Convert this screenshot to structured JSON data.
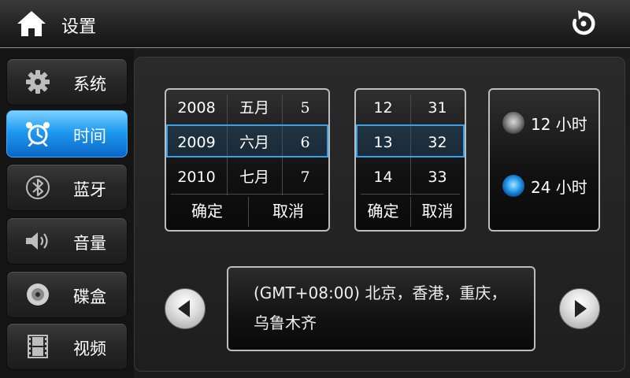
{
  "header": {
    "title": "设置",
    "home_icon": "home-icon",
    "back_icon": "back-icon"
  },
  "sidebar": {
    "items": [
      {
        "label": "系统",
        "icon": "gear-icon",
        "active": false
      },
      {
        "label": "时间",
        "icon": "alarm-clock-icon",
        "active": true
      },
      {
        "label": "蓝牙",
        "icon": "bluetooth-icon",
        "active": false
      },
      {
        "label": "音量",
        "icon": "speaker-icon",
        "active": false
      },
      {
        "label": "碟盒",
        "icon": "disc-icon",
        "active": false
      },
      {
        "label": "视频",
        "icon": "film-icon",
        "active": false
      }
    ]
  },
  "date_picker": {
    "years": [
      "2008",
      "2009",
      "2010"
    ],
    "months": [
      "五月",
      "六月",
      "七月"
    ],
    "days": [
      "5",
      "6",
      "7"
    ],
    "confirm": "确定",
    "cancel": "取消"
  },
  "time_picker": {
    "hours": [
      "12",
      "13",
      "14"
    ],
    "minutes": [
      "31",
      "32",
      "33"
    ],
    "confirm": "确定",
    "cancel": "取消"
  },
  "time_format": {
    "options": [
      "12 小时",
      "24 小时"
    ],
    "selected": "24 小时"
  },
  "timezone": {
    "line1": "(GMT+08:00) 北京，香港，重庆，",
    "line2": "乌鲁木齐"
  },
  "colors": {
    "accent": "#1f9af0",
    "selection_border": "#3aa0e8"
  }
}
